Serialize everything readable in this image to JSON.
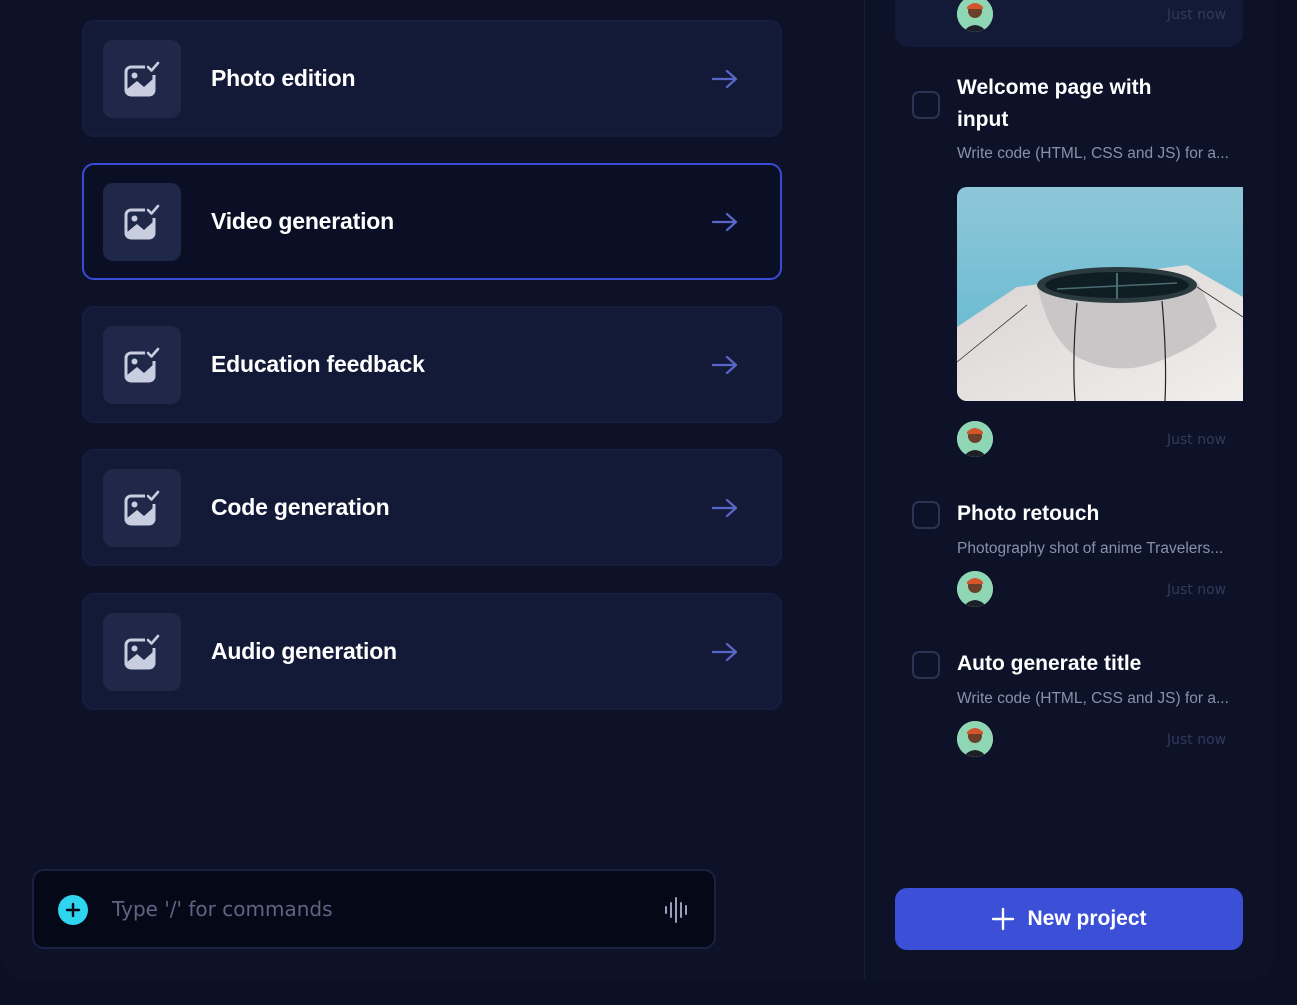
{
  "tools": [
    {
      "label": "Photo edition",
      "icon": "image-edit-icon",
      "active": false
    },
    {
      "label": "Video generation",
      "icon": "image-edit-icon",
      "active": true
    },
    {
      "label": "Education feedback",
      "icon": "image-edit-icon",
      "active": false
    },
    {
      "label": "Code generation",
      "icon": "image-edit-icon",
      "active": false
    },
    {
      "label": "Audio generation",
      "icon": "image-edit-icon",
      "active": false
    }
  ],
  "command_bar": {
    "placeholder": "Type '/' for commands",
    "add_icon": "plus-circle-icon",
    "voice_icon": "waveform-icon"
  },
  "projects": {
    "top_timestamp": "Just now",
    "items": [
      {
        "title": "Welcome page with input",
        "desc": "Write code (HTML, CSS and JS) for a...",
        "timestamp": "Just now",
        "has_image": true
      },
      {
        "title": "Photo retouch",
        "desc": "Photography shot of anime Travelers...",
        "timestamp": "Just now",
        "has_image": false
      },
      {
        "title": "Auto generate title",
        "desc": "Write code (HTML, CSS and JS) for a...",
        "timestamp": "Just now",
        "has_image": false
      }
    ]
  },
  "new_project_label": "New project",
  "colors": {
    "background": "#0c1025",
    "card": "#131a38",
    "accent": "#3b50d6",
    "active_border": "#3a4bd6",
    "cyan": "#2fd4ee"
  }
}
